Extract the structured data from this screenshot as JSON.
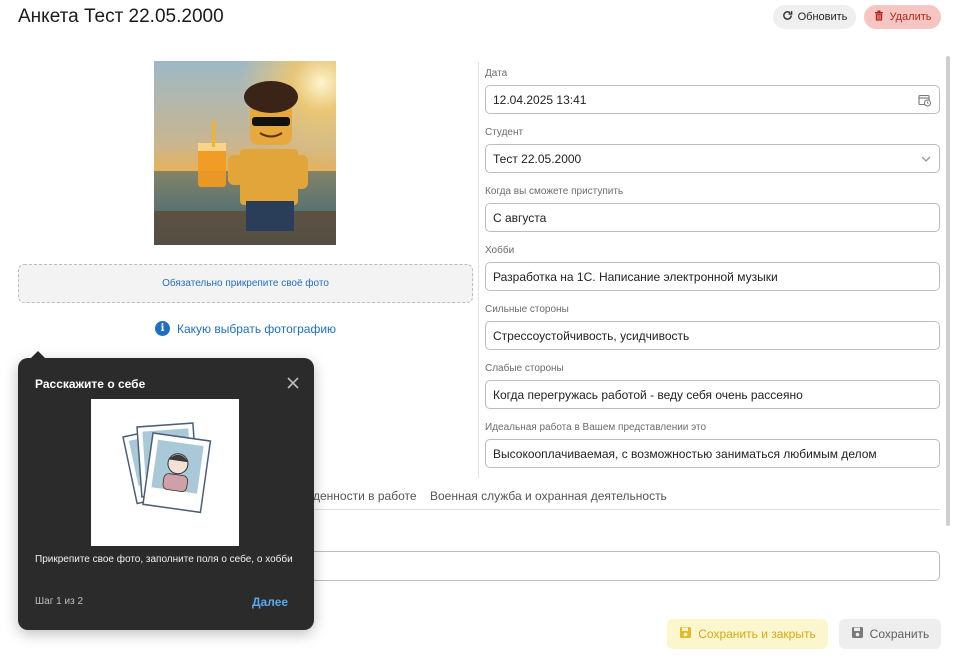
{
  "header": {
    "title": "Анкета Тест 22.05.2000",
    "refresh_label": "Обновить",
    "delete_label": "Удалить"
  },
  "photo": {
    "dropzone_text": "Обязательно прикрепите своё фото",
    "help_link": "Какую выбрать фотографию"
  },
  "form": {
    "date": {
      "label": "Дата",
      "value": "12.04.2025 13:41"
    },
    "student": {
      "label": "Студент",
      "value": "Тест 22.05.2000"
    },
    "start": {
      "label": "Когда вы сможете приступить",
      "value": "С августа"
    },
    "hobby": {
      "label": "Хобби",
      "value": "Разработка на 1С. Написание электронной музыки"
    },
    "strengths": {
      "label": "Сильные стороны",
      "value": "Стрессоустойчивость, усидчивость"
    },
    "weaknesses": {
      "label": "Слабые стороны",
      "value": "Когда перегружась работой - веду себя очень рассеяно"
    },
    "ideal_job": {
      "label": "Идеальная работа в Вашем представлении это",
      "value": "Высокооплачиваемая, с возможностью заниматься любимым делом"
    }
  },
  "tabs": [
    {
      "label": "денности в работе"
    },
    {
      "label": "Военная служба и охранная деятельность"
    }
  ],
  "footer": {
    "save_close_label": "Сохранить и закрыть",
    "save_label": "Сохранить"
  },
  "tour": {
    "title": "Расскажите о себе",
    "text": "Прикрепите свое фото, заполните поля о себе, о хобби",
    "step": "Шаг 1 из 2",
    "next_label": "Далее"
  },
  "colors": {
    "link": "#1e6fc4",
    "delete_bg": "#f7c6c2",
    "delete_fg": "#b3261e",
    "save_close_bg": "#fcf6cf",
    "save_close_fg": "#d3a912",
    "tour_bg": "#2b2b2b"
  }
}
